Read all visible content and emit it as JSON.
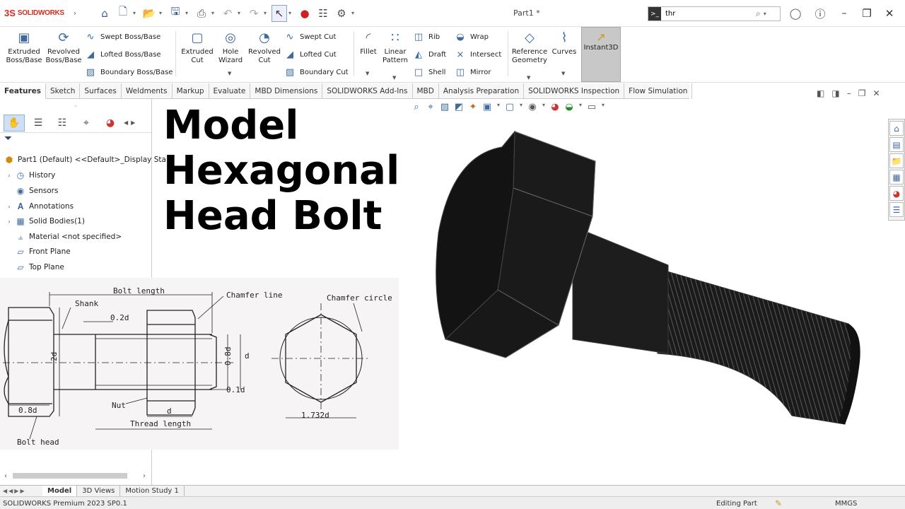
{
  "titlebar": {
    "logo_mark": "3S",
    "logo_text": "SOLIDWORKS",
    "document_title": "Part1 *",
    "search_value": "thr",
    "search_prompt_icon": ">_"
  },
  "ribbon": {
    "extruded_boss": "Extruded\nBoss/Base",
    "revolved_boss": "Revolved\nBoss/Base",
    "swept_boss": "Swept Boss/Base",
    "lofted_boss": "Lofted Boss/Base",
    "boundary_boss": "Boundary Boss/Base",
    "extruded_cut": "Extruded\nCut",
    "hole_wizard": "Hole\nWizard",
    "revolved_cut": "Revolved\nCut",
    "swept_cut": "Swept Cut",
    "lofted_cut": "Lofted Cut",
    "boundary_cut": "Boundary Cut",
    "fillet": "Fillet",
    "linear_pattern": "Linear\nPattern",
    "rib": "Rib",
    "draft": "Draft",
    "shell": "Shell",
    "wrap": "Wrap",
    "intersect": "Intersect",
    "mirror": "Mirror",
    "reference_geometry": "Reference\nGeometry",
    "curves": "Curves",
    "instant3d": "Instant3D"
  },
  "command_tabs": [
    "Features",
    "Sketch",
    "Surfaces",
    "Weldments",
    "Markup",
    "Evaluate",
    "MBD Dimensions",
    "SOLIDWORKS Add-Ins",
    "MBD",
    "Analysis Preparation",
    "SOLIDWORKS Inspection",
    "Flow Simulation"
  ],
  "feature_tree": {
    "root": "Part1 (Default) <<Default>_Display Sta",
    "items": [
      "History",
      "Sensors",
      "Annotations",
      "Solid Bodies(1)",
      "Material <not specified>",
      "Front Plane",
      "Top Plane"
    ]
  },
  "overlay_title": [
    "Model",
    "Hexagonal",
    "Head Bolt"
  ],
  "drawing": {
    "bolt_length": "Bolt length",
    "shank": "Shank",
    "chamfer_line": "Chamfer line",
    "chamfer_circle": "Chamfer circle",
    "dim_02d": "0.2d",
    "dim_2d": "2d",
    "dim_08d": "0.8d",
    "dim_08d_head": "0.8d",
    "dim_d": "d",
    "dim_01d": "0.1d",
    "nut": "Nut",
    "dim_d_thread": "d",
    "thread_length": "Thread length",
    "bolt_head": "Bolt head",
    "dim_1732d": "1.732d"
  },
  "bottom_tabs": [
    "Model",
    "3D Views",
    "Motion Study 1"
  ],
  "statusbar": {
    "product": "SOLIDWORKS Premium 2023 SP0.1",
    "mode": "Editing Part",
    "units": "MMGS"
  },
  "colors": {
    "accent": "#3e6aa0",
    "brand": "#d52b1e",
    "bolt": "#1c1c1c"
  }
}
